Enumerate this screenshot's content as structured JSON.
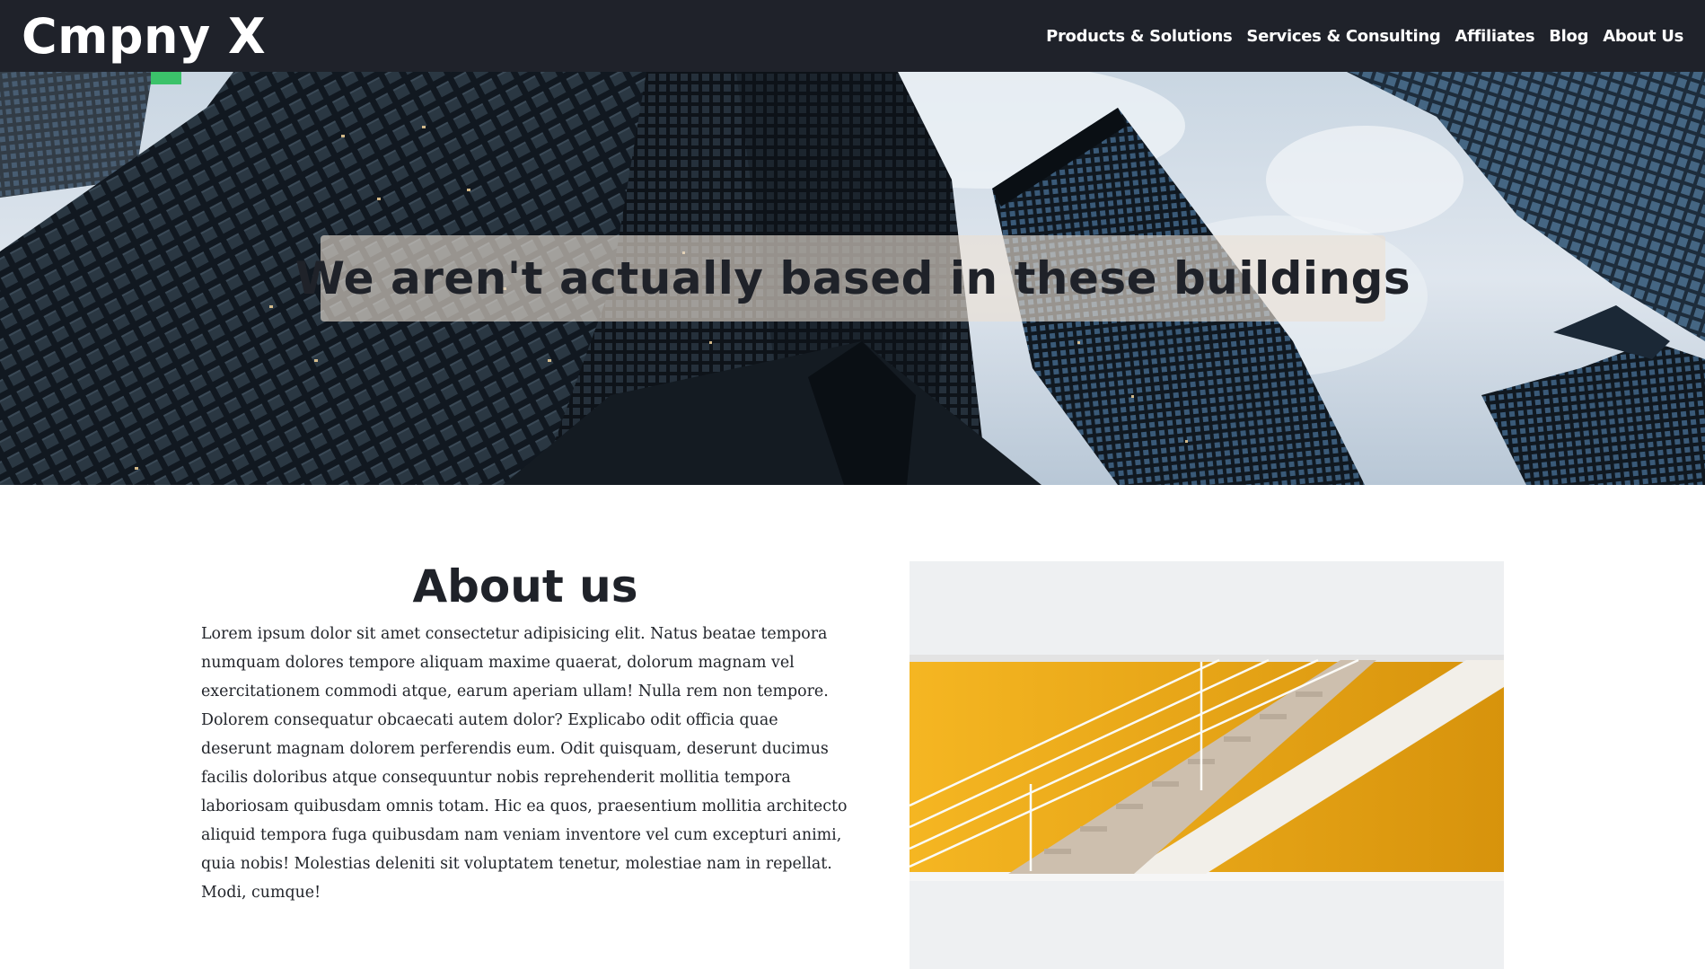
{
  "header": {
    "logo": "Cmpny X",
    "nav": [
      {
        "label": "Products & Solutions"
      },
      {
        "label": "Services & Consulting"
      },
      {
        "label": "Affiliates"
      },
      {
        "label": "Blog"
      },
      {
        "label": "About Us"
      }
    ]
  },
  "hero": {
    "caption": "We aren't actually based in these buildings"
  },
  "about": {
    "title": "About us",
    "body": "Lorem ipsum dolor sit amet consectetur adipisicing elit. Natus beatae tempora numquam dolores tempore aliquam maxime quaerat, dolorum magnam vel exercitationem commodi atque, earum aperiam ullam! Nulla rem non tempore. Dolorem consequatur obcaecati autem dolor? Explicabo odit officia quae deserunt magnam dolorem perferendis eum. Odit quisquam, deserunt ducimus facilis doloribus atque consequuntur nobis reprehenderit mollitia tempora laboriosam quibusdam omnis totam. Hic ea quos, praesentium mollitia architecto aliquid tempora fuga quibusdam nam veniam inventore vel cum excepturi animi, quia nobis! Molestias deleniti sit voluptatem tenetur, molestiae nam in repellat. Modi, cumque!"
  },
  "colors": {
    "header_bg": "#1f222a",
    "text_dark": "#1f2229",
    "accent_orange": "#f0a417"
  }
}
